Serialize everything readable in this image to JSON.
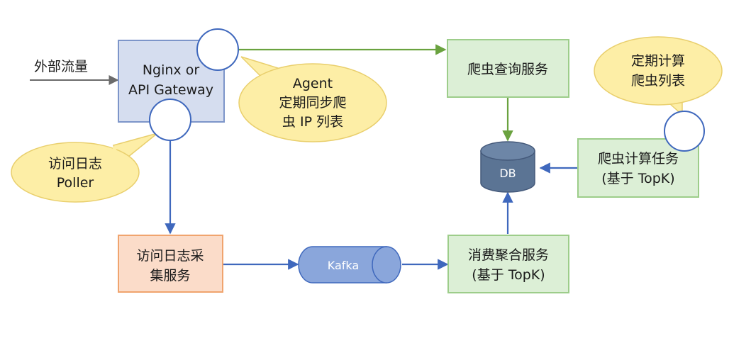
{
  "nodes": {
    "external_traffic": "外部流量",
    "gateway": {
      "line1": "Nginx or",
      "line2": "API Gateway"
    },
    "crawler_query": "爬虫查询服务",
    "db": "DB",
    "crawler_compute": {
      "line1": "爬虫计算任务",
      "line2": "(基于 TopK)"
    },
    "log_collect": {
      "line1": "访问日志采",
      "line2": "集服务"
    },
    "kafka": "Kafka",
    "consume_aggregate": {
      "line1": "消费聚合服务",
      "line2": "(基于 TopK)"
    }
  },
  "callouts": {
    "agent": {
      "line1": "Agent",
      "line2": "定期同步爬",
      "line3": "虫 IP 列表"
    },
    "poller": {
      "line1": "访问日志",
      "line2": "Poller"
    },
    "compute": {
      "line1": "定期计算",
      "line2": "爬虫列表"
    }
  },
  "colors": {
    "gateway_fill": "#d5ddef",
    "gateway_stroke": "#7d95c9",
    "green_fill": "#dcefd6",
    "green_stroke": "#9dcd8a",
    "orange_fill": "#fbdcc9",
    "orange_stroke": "#f0a46e",
    "callout_fill": "#fdeea6",
    "callout_stroke": "#e9cf6d",
    "db_fill": "#5b7494",
    "kafka_fill": "#8aa6db",
    "arrow_blue": "#3f68bd",
    "arrow_green": "#6aa23f",
    "arrow_gray": "#6b6b6b"
  }
}
